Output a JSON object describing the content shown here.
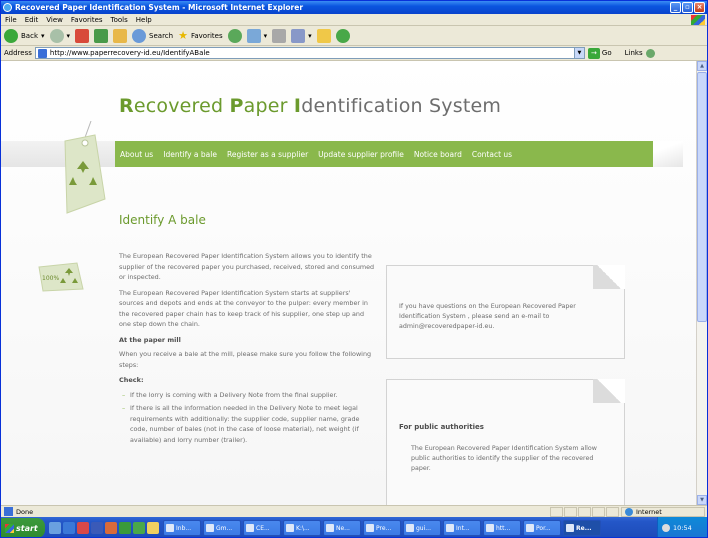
{
  "window": {
    "title": "Recovered Paper Identification System - Microsoft Internet Explorer"
  },
  "menu": [
    "File",
    "Edit",
    "View",
    "Favorites",
    "Tools",
    "Help"
  ],
  "toolbar": {
    "back": "Back",
    "search": "Search",
    "favorites": "Favorites"
  },
  "address": {
    "label": "Address",
    "url": "http://www.paperrecovery-id.eu/IdentifyABale",
    "go": "Go",
    "links": "Links"
  },
  "site": {
    "title_parts": [
      {
        "text": "Recovered ",
        "accent": true,
        "part": "R"
      },
      {
        "text": "ecovered ",
        "accent": false
      }
    ],
    "title": {
      "r": "R",
      "ecovered": "ecovered ",
      "p": "P",
      "aper": "aper ",
      "i": "I",
      "dentification": "dentification System"
    },
    "nav": [
      "About us",
      "Identify a bale",
      "Register as a supplier",
      "Update supplier profile",
      "Notice board",
      "Contact us"
    ],
    "tag_label": "100%"
  },
  "content": {
    "heading": "Identify A bale",
    "para1": "The European Recovered Paper Identification System allows you to identify the supplier of the recovered paper you purchased, received, stored and consumed or inspected.",
    "para2": "The European Recovered Paper Identification System starts at suppliers' sources and depots and ends at the conveyor to the pulper: every member in the recovered paper chain has to keep track of his supplier, one step up and one step down the chain.",
    "subheading": "At the paper mill",
    "para3": "When you receive a bale at the mill, please make sure you follow the following steps:",
    "check_label": "Check:",
    "checks": [
      "If the lorry is coming with a Delivery Note from the final supplier.",
      "If there is all the information needed in the Delivery Note to meet legal requirements with additionally: the supplier code, supplier name, grade code, number of bales (not in the case of loose material), net weight (if available) and lorry number (trailer)."
    ]
  },
  "card1": {
    "text": "If you have questions on the European Recovered Paper Identification System , please send an e-mail to admin@recoveredpaper-id.eu."
  },
  "card2": {
    "heading": "For public authorities",
    "text": "The European Recovered Paper Identification System allow public authorities to identify the supplier of the recovered paper."
  },
  "status": {
    "text": "Done",
    "zone": "Internet"
  },
  "taskbar": {
    "start": "start",
    "tasks": [
      "Inb...",
      "Gm...",
      "CE...",
      "K:\\...",
      "Ne...",
      "Pre...",
      "gui...",
      "Int...",
      "htt...",
      "Por...",
      "Re..."
    ],
    "clock": "10:54"
  },
  "colors": {
    "accent": "#8ab84c",
    "heading": "#6b9a2d",
    "text": "#6d6d6d"
  }
}
